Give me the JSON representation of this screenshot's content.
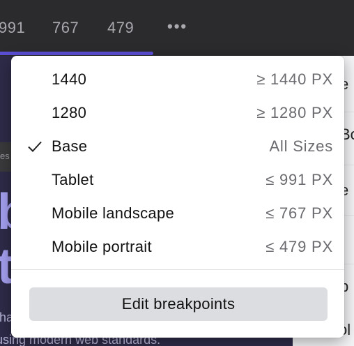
{
  "toolbar": {
    "breakpoint_tabs": [
      "991",
      "767",
      "479"
    ],
    "more_label": "•••"
  },
  "canvas": {
    "breadcrumb_fragment": "es",
    "hero_line1": "b",
    "hero_line2": "te",
    "hero_sub1": "tha",
    "hero_sub2": "using modern web standards."
  },
  "right_panel": {
    "letters": [
      "e",
      "Bo",
      "e",
      "p",
      "ol"
    ]
  },
  "dropdown": {
    "items": [
      {
        "label": "1440",
        "hint": "≥ 1440 PX",
        "selected": false
      },
      {
        "label": "1280",
        "hint": "≥ 1280 PX",
        "selected": false
      },
      {
        "label": "Base",
        "hint": "All Sizes",
        "selected": true
      },
      {
        "label": "Tablet",
        "hint": "≤ 991 PX",
        "selected": false
      },
      {
        "label": "Mobile landscape",
        "hint": "≤ 767 PX",
        "selected": false
      },
      {
        "label": "Mobile portrait",
        "hint": "≤ 479 PX",
        "selected": false
      }
    ],
    "edit_button_label": "Edit breakpoints"
  },
  "colors": {
    "accent": "#5b4fd6",
    "topbar_bg": "#2b2b2d",
    "dropdown_bg": "#ffffff",
    "button_bg": "#dcdde1"
  }
}
